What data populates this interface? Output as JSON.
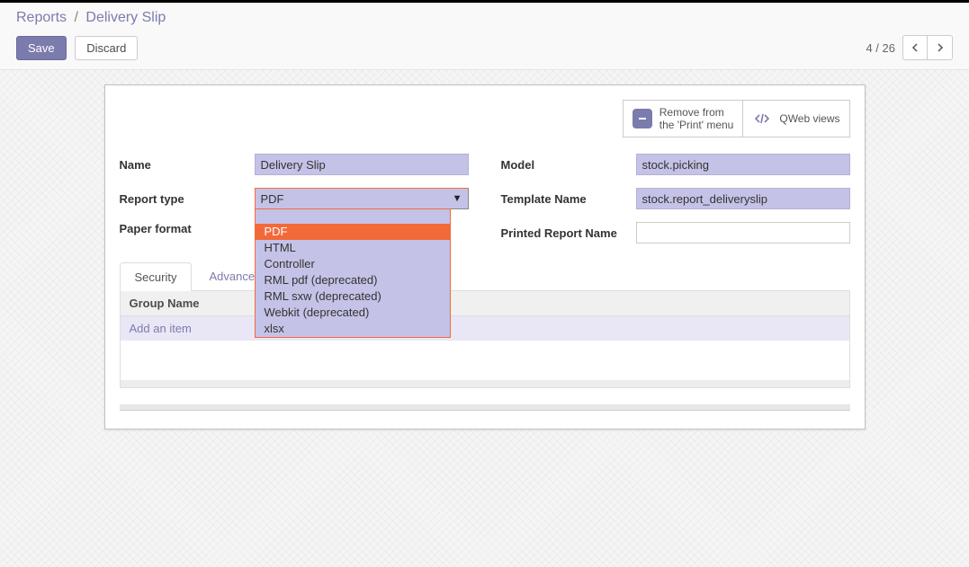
{
  "breadcrumb": {
    "root": "Reports",
    "current": "Delivery Slip"
  },
  "header": {
    "save": "Save",
    "discard": "Discard",
    "pager": {
      "current": 4,
      "total": 26
    }
  },
  "stats": {
    "remove_line1": "Remove from",
    "remove_line2": "the 'Print' menu",
    "qweb": "QWeb views"
  },
  "labels": {
    "name": "Name",
    "report_type": "Report type",
    "paper_format": "Paper format",
    "model": "Model",
    "template_name": "Template Name",
    "printed_name": "Printed Report Name"
  },
  "fields": {
    "name": "Delivery Slip",
    "report_type": "PDF",
    "model": "stock.picking",
    "template_name": "stock.report_deliveryslip",
    "printed_name": ""
  },
  "dropdown_options": [
    "PDF",
    "HTML",
    "Controller",
    "RML pdf (deprecated)",
    "RML sxw (deprecated)",
    "Webkit (deprecated)",
    "xlsx"
  ],
  "tabs": {
    "security": "Security",
    "advanced": "Advanced"
  },
  "table": {
    "header": "Group Name",
    "add_item": "Add an item"
  }
}
